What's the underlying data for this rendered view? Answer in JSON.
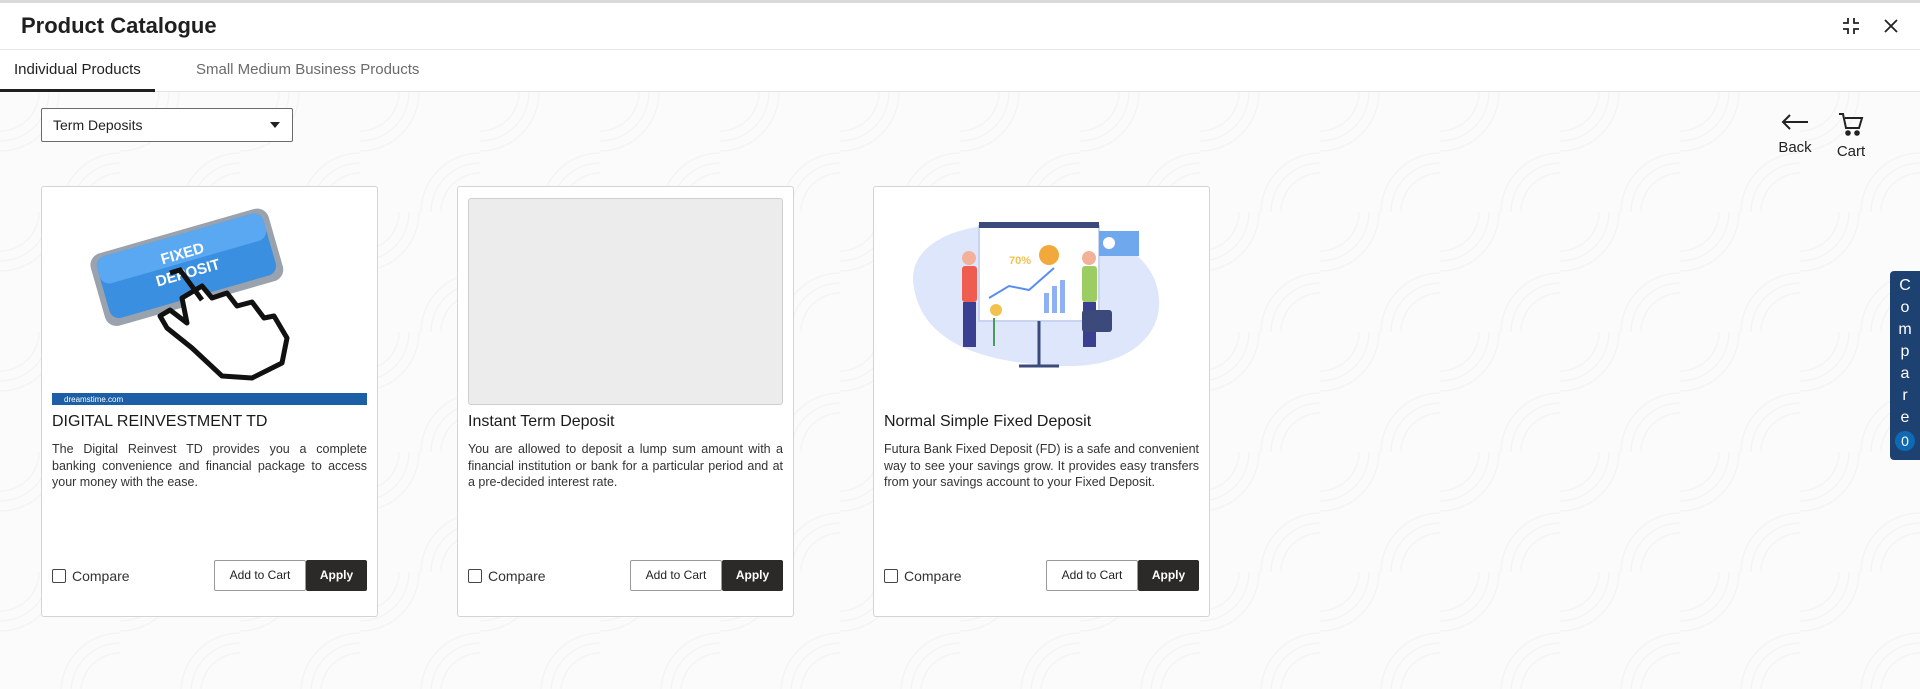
{
  "header": {
    "title": "Product Catalogue"
  },
  "tabs": [
    {
      "label": "Individual Products",
      "active": true
    },
    {
      "label": "Small Medium Business Products",
      "active": false
    }
  ],
  "filter": {
    "selected": "Term Deposits"
  },
  "actions": {
    "back_label": "Back",
    "cart_label": "Cart"
  },
  "cards": [
    {
      "title": "DIGITAL REINVESTMENT TD",
      "description": "The Digital Reinvest TD provides you a complete banking convenience and financial package to access your money with the ease.",
      "image_text": "FIXED DEPOSIT",
      "image_footer": "dreamstime.com",
      "compare_label": "Compare",
      "add_to_cart_label": "Add to Cart",
      "apply_label": "Apply"
    },
    {
      "title": "Instant Term Deposit",
      "description": "You are allowed to deposit a lump sum amount with a financial institution or bank for a particular period and at a pre-decided interest rate.",
      "compare_label": "Compare",
      "add_to_cart_label": "Add to Cart",
      "apply_label": "Apply"
    },
    {
      "title": "Normal Simple Fixed Deposit",
      "description": "Futura Bank Fixed Deposit (FD) is a safe and convenient way to see your savings grow. It provides easy transfers from your savings account to your Fixed Deposit.",
      "image_percent": "70%",
      "compare_label": "Compare",
      "add_to_cart_label": "Add to Cart",
      "apply_label": "Apply"
    }
  ],
  "compare_tab": {
    "label": "Compare",
    "count": "0"
  },
  "colors": {
    "accent_dark": "#2c2a28",
    "compare_tab": "#1d4170",
    "compare_badge": "#0f6ab3"
  },
  "icons": [
    "expand-icon",
    "close-icon",
    "back-arrow-icon",
    "cart-icon",
    "dropdown-caret-icon"
  ]
}
